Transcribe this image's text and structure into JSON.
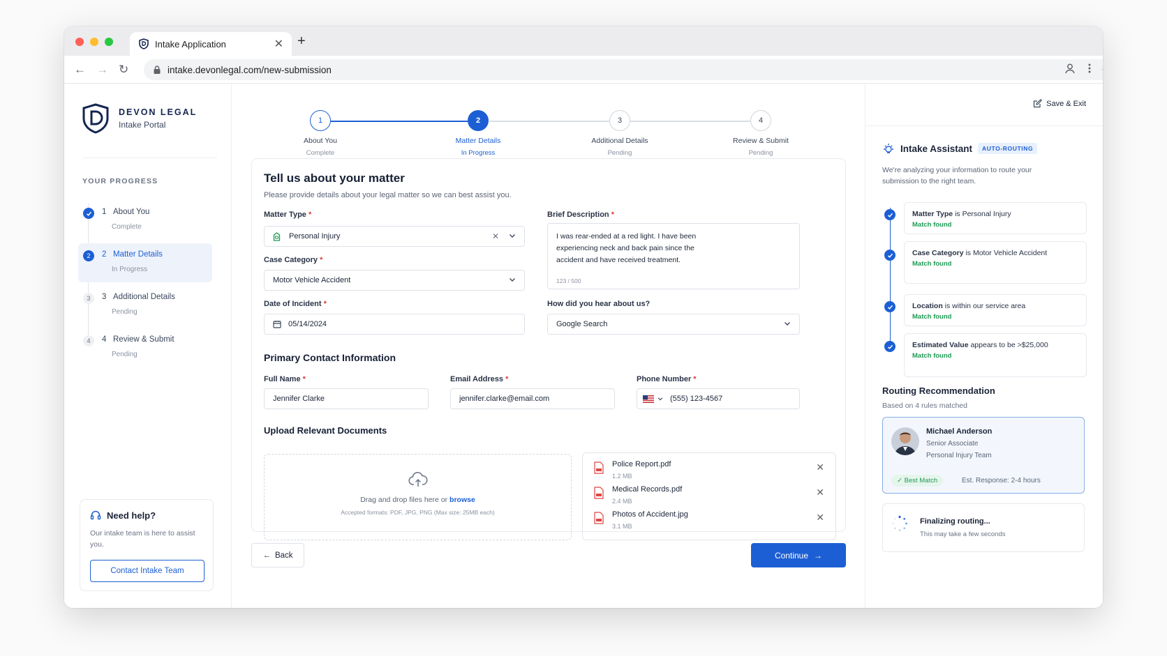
{
  "browser": {
    "tab_title": "Intake Application",
    "url": "intake.devonlegal.com/new-submission"
  },
  "brand": {
    "name": "DEVON LEGAL",
    "sub": "Intake Portal"
  },
  "sidebar": {
    "progress_title": "YOUR PROGRESS",
    "steps": [
      {
        "num": "1",
        "label": "About You",
        "status": "Complete"
      },
      {
        "num": "2",
        "label": "Matter Details",
        "status": "In Progress"
      },
      {
        "num": "3",
        "label": "Additional Details",
        "status": "Pending"
      },
      {
        "num": "4",
        "label": "Review & Submit",
        "status": "Pending"
      }
    ],
    "help": {
      "title": "Need help?",
      "text": "Our intake team is here to assist you.",
      "button": "Contact Intake Team"
    }
  },
  "stepper": [
    {
      "num": "1",
      "label": "About You",
      "status": "Complete"
    },
    {
      "num": "2",
      "label": "Matter Details",
      "status": "In Progress"
    },
    {
      "num": "3",
      "label": "Additional Details",
      "status": "Pending"
    },
    {
      "num": "4",
      "label": "Review & Submit",
      "status": "Pending"
    }
  ],
  "form": {
    "title": "Tell us about your matter",
    "subtitle": "Please provide details about your legal matter so we can best assist you.",
    "matter_type": {
      "label": "Matter Type",
      "value": "Personal Injury"
    },
    "case_category": {
      "label": "Case Category",
      "value": "Motor Vehicle Accident"
    },
    "date_incident": {
      "label": "Date of Incident",
      "value": "05/14/2024"
    },
    "brief": {
      "label": "Brief Description",
      "line1": "I was rear-ended at a red light. I have been",
      "line2": "experiencing neck and back pain since the",
      "line3": "accident and have received treatment.",
      "count": "123 / 500"
    },
    "hear": {
      "label": "How did you hear about us?",
      "value": "Google Search"
    },
    "contact_title": "Primary Contact Information",
    "full_name": {
      "label": "Full Name",
      "value": "Jennifer Clarke"
    },
    "email": {
      "label": "Email Address",
      "value": "jennifer.clarke@email.com"
    },
    "phone": {
      "label": "Phone Number",
      "value": "(555) 123-4567"
    },
    "upload_title": "Upload Relevant Documents",
    "drop_text": "Drag and drop files here or",
    "browse": "browse",
    "accepted": "Accepted formats: PDF, JPG, PNG (Max size: 25MB each)",
    "files": [
      {
        "name": "Police Report.pdf",
        "size": "1.2 MB"
      },
      {
        "name": "Medical Records.pdf",
        "size": "2.4 MB"
      },
      {
        "name": "Photos of Accident.jpg",
        "size": "3.1 MB"
      }
    ],
    "back": "Back",
    "continue": "Continue"
  },
  "assistant": {
    "save_exit": "Save & Exit",
    "title": "Intake Assistant",
    "badge": "AUTO-ROUTING",
    "desc": "We're analyzing your information to route your submission to the right team.",
    "matches": [
      {
        "key": "Matter Type",
        "rest": " is Personal Injury",
        "found": "Match found"
      },
      {
        "key": "Case Category",
        "rest": " is Motor Vehicle Accident",
        "found": "Match found"
      },
      {
        "key": "Location",
        "rest": " is within our service area",
        "found": "Match found"
      },
      {
        "key": "Estimated Value",
        "rest": " appears to be >$25,000",
        "found": "Match found"
      }
    ],
    "routing_title": "Routing Recommendation",
    "routing_sub": "Based on 4 rules matched",
    "person": {
      "name": "Michael Anderson",
      "title": "Senior Associate",
      "team": "Personal Injury Team",
      "badge": "Best Match",
      "response": "Est. Response: 2-4 hours"
    },
    "finalizing": "Finalizing routing...",
    "finalizing_sub": "This may take a few seconds"
  },
  "colors": {
    "accent": "#1c5fd4",
    "success": "#1f9a55",
    "brand_navy": "#142550"
  }
}
